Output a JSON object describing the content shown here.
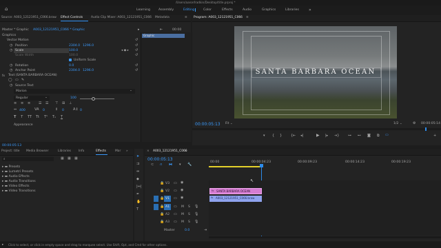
{
  "title_path": "/Users/aaronfradkin/Desktop/title.prproj *",
  "workspaces": [
    {
      "label": "Learning",
      "active": false
    },
    {
      "label": "Assembly",
      "active": false
    },
    {
      "label": "Editing",
      "active": true
    },
    {
      "label": "Color",
      "active": false
    },
    {
      "label": "Effects",
      "active": false
    },
    {
      "label": "Audio",
      "active": false
    },
    {
      "label": "Graphics",
      "active": false
    },
    {
      "label": "Libraries",
      "active": false
    }
  ],
  "source_tabs": {
    "source": "Source: A003_12121951_C066.braw",
    "effect_controls": "Effect Controls",
    "audio_clip_mixer": "Audio Clip Mixer: A003_12121951_C066",
    "metadata": "Metadata"
  },
  "effect_controls": {
    "master": "Master * Graphic",
    "clip": "A003_12121951_C066 * Graphic",
    "time": "00:00",
    "clip_bar_label": "Graphic",
    "graphics_heading": "Graphics",
    "vector_motion": "Vector Motion",
    "position_label": "Position",
    "position_x": "2304.0",
    "position_y": "1296.0",
    "scale_label": "Scale",
    "scale_value": "100.0",
    "scale_width_label": "Scale Width",
    "scale_width_value": "100.0",
    "uniform_scale": "Uniform Scale",
    "rotation_label": "Rotation",
    "rotation_value": "0.0",
    "anchor_label": "Anchor Point",
    "anchor_x": "2304.0",
    "anchor_y": "1296.0",
    "text_layer": "Text (SANTA BARBARA OCEAN)",
    "source_text": "Source Text",
    "font": "Marion",
    "font_style": "Regular",
    "font_size": "100",
    "tracking": "400",
    "kerning": "0",
    "leading": "0",
    "baseline": "0",
    "appearance": "Appearance",
    "timecode": "00:00:05:13"
  },
  "program": {
    "label": "Program: A003_12121951_C066",
    "title_text": "SANTA BARBARA OCEAN",
    "timecode": "00:00:05:13",
    "fit": "Fit",
    "resolution": "1/2",
    "duration": "00:00:05:14"
  },
  "project_tabs": [
    {
      "label": "Project: title",
      "active": false
    },
    {
      "label": "Media Browser",
      "active": false
    },
    {
      "label": "Libraries",
      "active": false
    },
    {
      "label": "Info",
      "active": false
    },
    {
      "label": "Effects",
      "active": true
    },
    {
      "label": "Mar",
      "active": false
    }
  ],
  "effects_folders": [
    "Presets",
    "Lumetri Presets",
    "Audio Effects",
    "Audio Transitions",
    "Video Effects",
    "Video Transitions"
  ],
  "timeline": {
    "sequence": "A003_12121951_C066",
    "timecode": "00:00:05:13",
    "ruler": [
      "00:00",
      "00:00:04:23",
      "00:00:09:23",
      "00:00:14:23",
      "00:00:19:23"
    ],
    "video_tracks": [
      "V3",
      "V2",
      "V1"
    ],
    "audio_tracks": [
      "A1",
      "A2",
      "A3"
    ],
    "master_label": "Master",
    "master_value": "0.0",
    "graphic_clip": "SANTA BARBARA OCEAN",
    "video_clip": "A003_12121951_C066.braw"
  },
  "status_bar": "Click to select, or click in empty space and drag to marquee select. Use Shift, Opt, and Cmd for other options.",
  "colors": {
    "accent_blue": "#2d8ceb",
    "graphic_clip": "#d57dd1",
    "video_clip": "#8fa3ee",
    "playhead": "#2d8ceb",
    "work_area": "#e4d12b"
  }
}
